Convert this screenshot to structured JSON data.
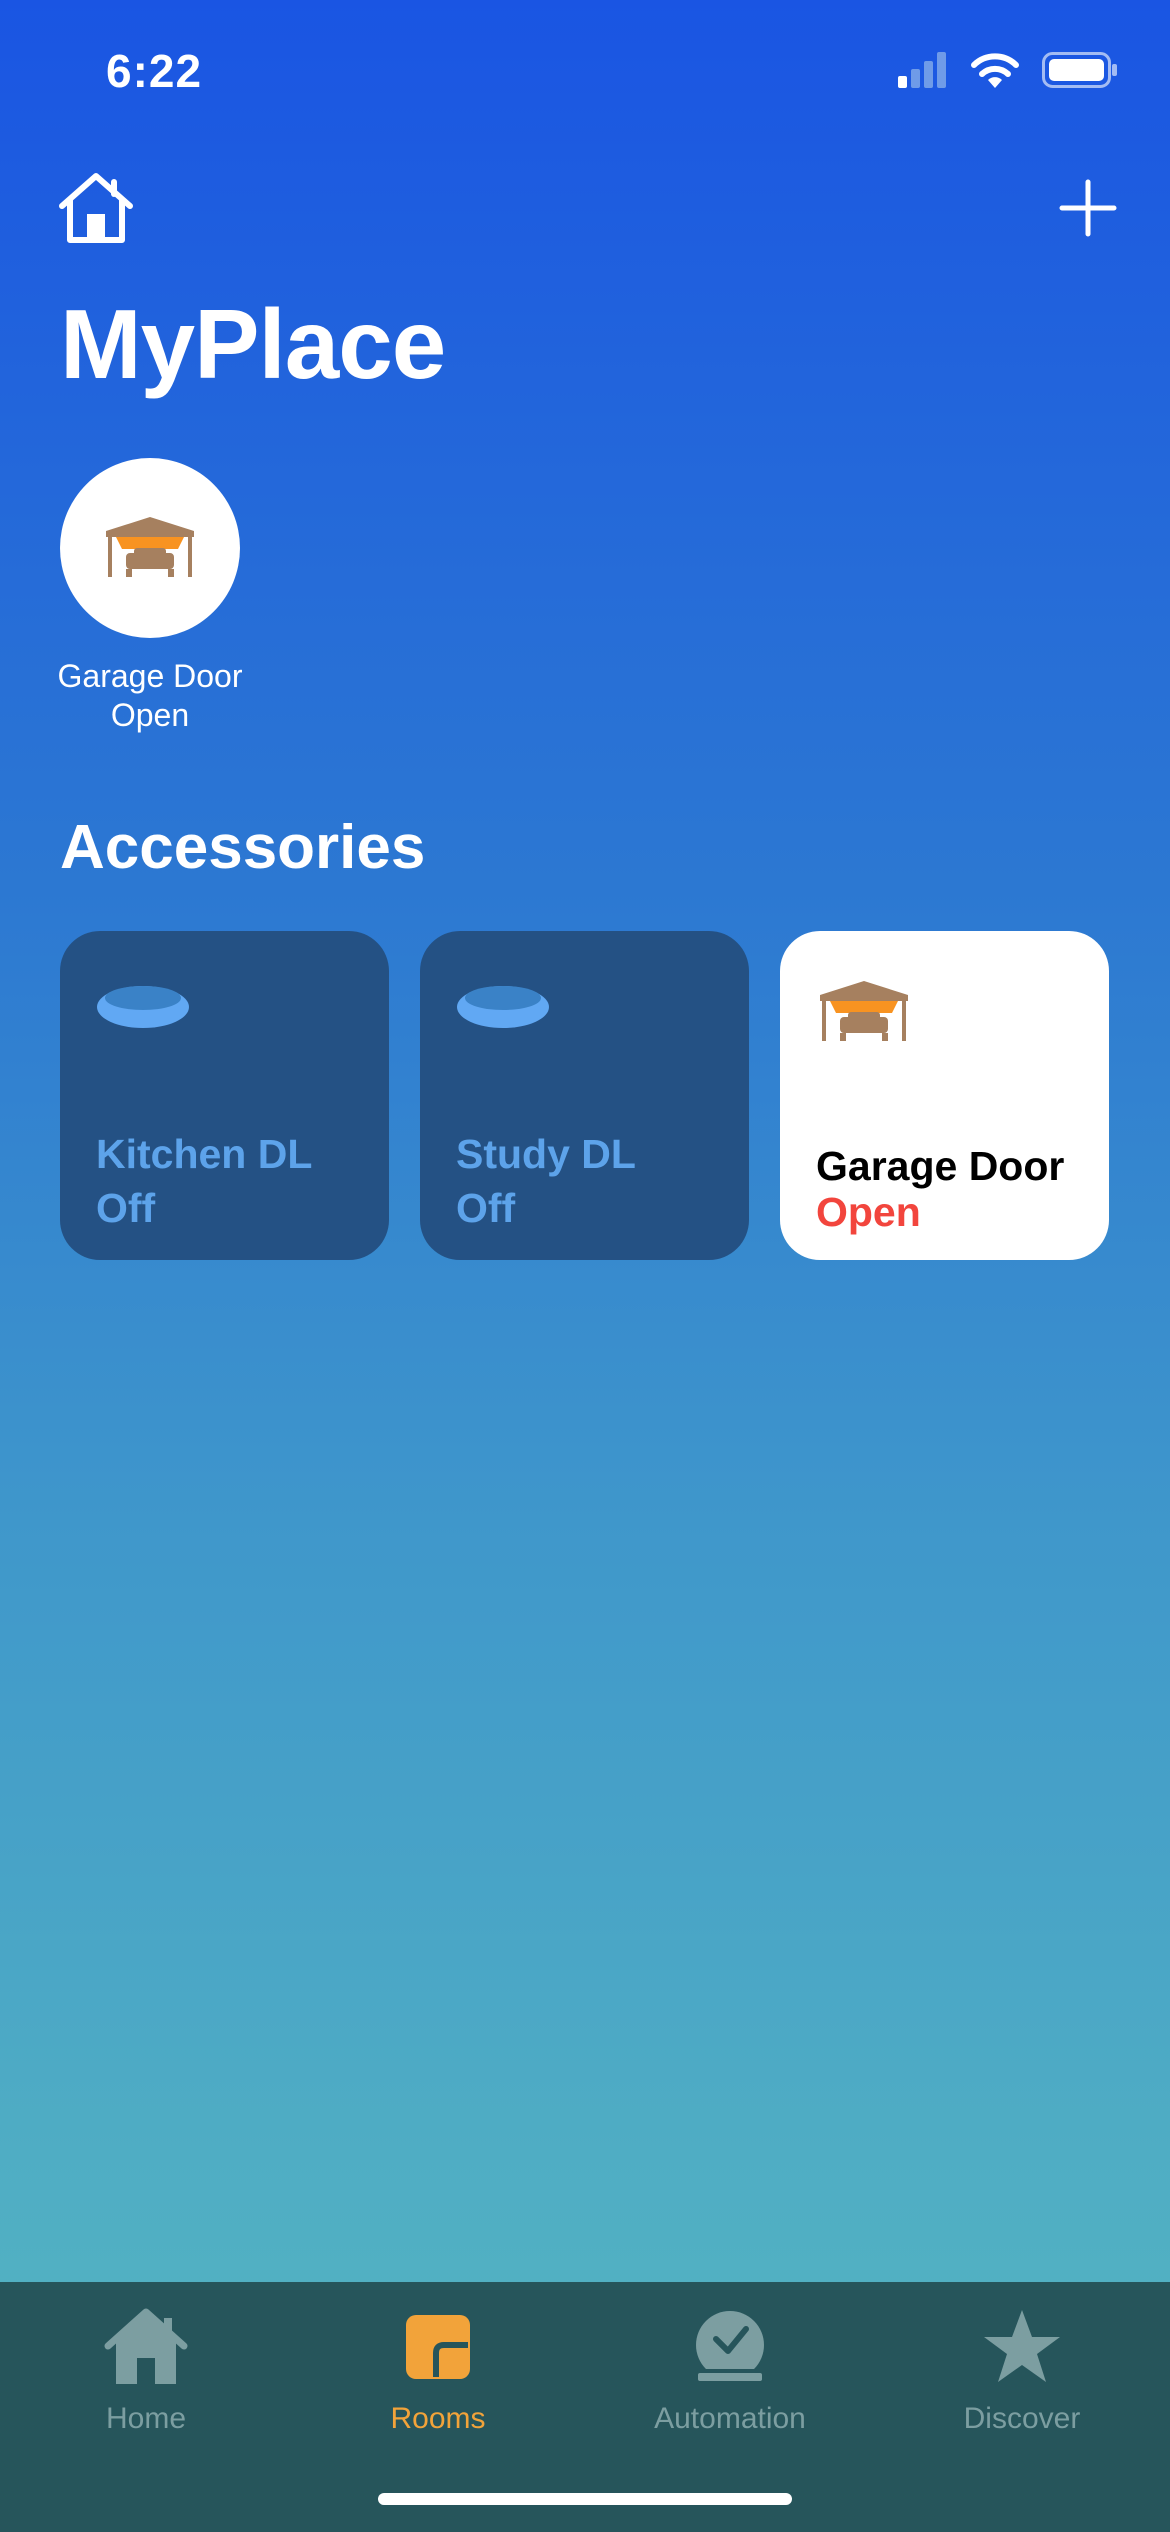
{
  "status_bar": {
    "time": "6:22"
  },
  "header": {
    "title": "MyPlace"
  },
  "favorite": {
    "name": "Garage Door",
    "status": "Open"
  },
  "accessories": {
    "title": "Accessories",
    "items": [
      {
        "name": "Kitchen DL",
        "status": "Off",
        "icon": "downlight-icon"
      },
      {
        "name": "Study DL",
        "status": "Off",
        "icon": "downlight-icon"
      },
      {
        "name": "Garage Door",
        "status": "Open",
        "icon": "garage-door-icon"
      }
    ]
  },
  "tab_bar": {
    "tabs": [
      {
        "label": "Home",
        "icon": "home-icon",
        "active": false
      },
      {
        "label": "Rooms",
        "icon": "rooms-icon",
        "active": true
      },
      {
        "label": "Automation",
        "icon": "automation-icon",
        "active": false
      },
      {
        "label": "Discover",
        "icon": "star-icon",
        "active": false
      }
    ]
  },
  "colors": {
    "accent": "#f2a33a",
    "alert": "#f2453d",
    "tile_off_bg": "#245184",
    "tile_off_text": "#5da3ea",
    "tab_bar_bg": "#26555b"
  }
}
